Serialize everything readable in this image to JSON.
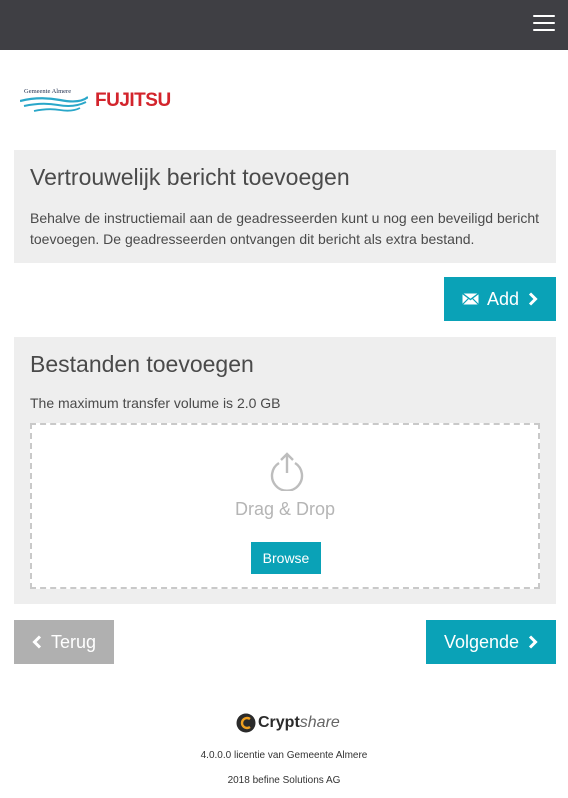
{
  "header": {
    "menu_icon": "hamburger-menu-icon",
    "bar_color": "#3f3f44"
  },
  "logos": {
    "almere_text": "Gemeente Almere",
    "fujitsu_text": "FUJITSU"
  },
  "confidential_panel": {
    "title": "Vertrouwelijk bericht toevoegen",
    "description": "Behalve de instructiemail aan de geadresseerden kunt u nog een beveiligd bericht toevoegen. De geadresseerden ontvangen dit bericht als extra bestand.",
    "add_label": "Add",
    "add_icon": "envelope-icon"
  },
  "files_panel": {
    "title": "Bestanden toevoegen",
    "max_transfer": "The maximum transfer volume is 2.0 GB",
    "drop_text": "Drag & Drop",
    "browse_label": "Browse",
    "upload_icon": "upload-icon"
  },
  "navigation": {
    "back_label": "Terug",
    "next_label": "Volgende"
  },
  "footer": {
    "brand_bold": "Crypt",
    "brand_light": "share",
    "license_line": "4.0.0.0 licentie van Gemeente Almere",
    "copyright_line": "2018 befine Solutions AG"
  },
  "colors": {
    "accent": "#0aa2b7",
    "panel_bg": "#eeeeee",
    "back_button": "#b0b0b0",
    "fujitsu_red": "#d3242c"
  }
}
